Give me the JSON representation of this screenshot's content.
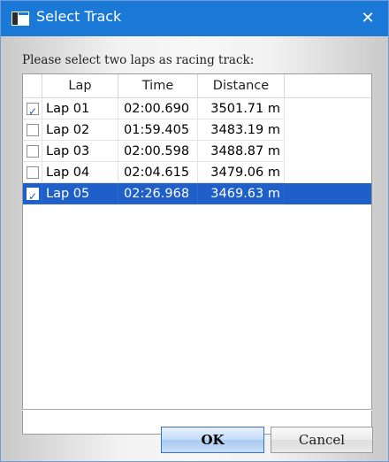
{
  "window": {
    "title": "Select Track",
    "close_glyph": "✕"
  },
  "prompt": "Please select two laps as racing track:",
  "columns": [
    "Lap",
    "Time",
    "Distance"
  ],
  "rows": [
    {
      "checked": true,
      "lap": "Lap 01",
      "time": "02:00.690",
      "distance": "3501.71 m",
      "selected": false
    },
    {
      "checked": false,
      "lap": "Lap 02",
      "time": "01:59.405",
      "distance": "3483.19 m",
      "selected": false
    },
    {
      "checked": false,
      "lap": "Lap 03",
      "time": "02:00.598",
      "distance": "3488.87 m",
      "selected": false
    },
    {
      "checked": false,
      "lap": "Lap 04",
      "time": "02:04.615",
      "distance": "3479.06 m",
      "selected": false
    },
    {
      "checked": true,
      "lap": "Lap 05",
      "time": "02:26.968",
      "distance": "3469.63 m",
      "selected": true
    }
  ],
  "buttons": {
    "ok": "OK",
    "cancel": "Cancel"
  },
  "colors": {
    "titlebar": "#1a78d6",
    "selection": "#1e5fc9"
  }
}
